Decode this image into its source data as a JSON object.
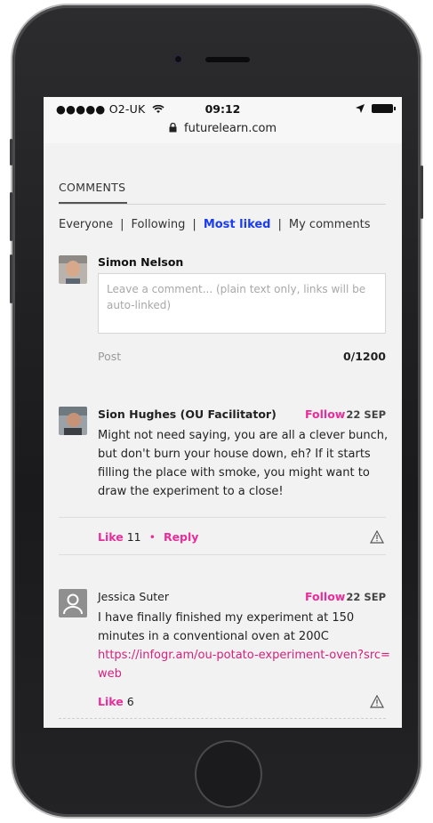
{
  "status_bar": {
    "carrier": "●●●●● O2-UK",
    "time": "09:12",
    "url": "futurelearn.com"
  },
  "comments_section": {
    "title": "COMMENTS",
    "filters": [
      {
        "label": "Everyone",
        "active": false
      },
      {
        "label": "Following",
        "active": false
      },
      {
        "label": "Most liked",
        "active": true
      },
      {
        "label": "My comments",
        "active": false
      }
    ]
  },
  "composer": {
    "user_name": "Simon Nelson",
    "placeholder": "Leave a comment... (plain text only, links will be auto-linked)",
    "post_label": "Post",
    "char_count": "0/1200"
  },
  "comments": [
    {
      "author": "Sion Hughes (OU Facilitator)",
      "follow_label": "Follow",
      "date": "22 SEP",
      "body": "Might not need saying, you are all a clever bunch, but don't burn your house down, eh? If it starts filling the place with smoke, you might want to draw the experiment to a close!",
      "like_label": "Like",
      "like_count": "11",
      "reply_label": "Reply"
    },
    {
      "author": "Jessica Suter",
      "follow_label": "Follow",
      "date": "22 SEP",
      "body": "I have finally finished my experiment at 150 minutes in a conventional oven at 200C",
      "link": "https://infogr.am/ou-potato-experiment-oven?src=web",
      "like_label": "Like",
      "like_count": "6"
    }
  ],
  "colors": {
    "accent_pink": "#ea2d9a",
    "active_filter_blue": "#1a3cf2"
  }
}
